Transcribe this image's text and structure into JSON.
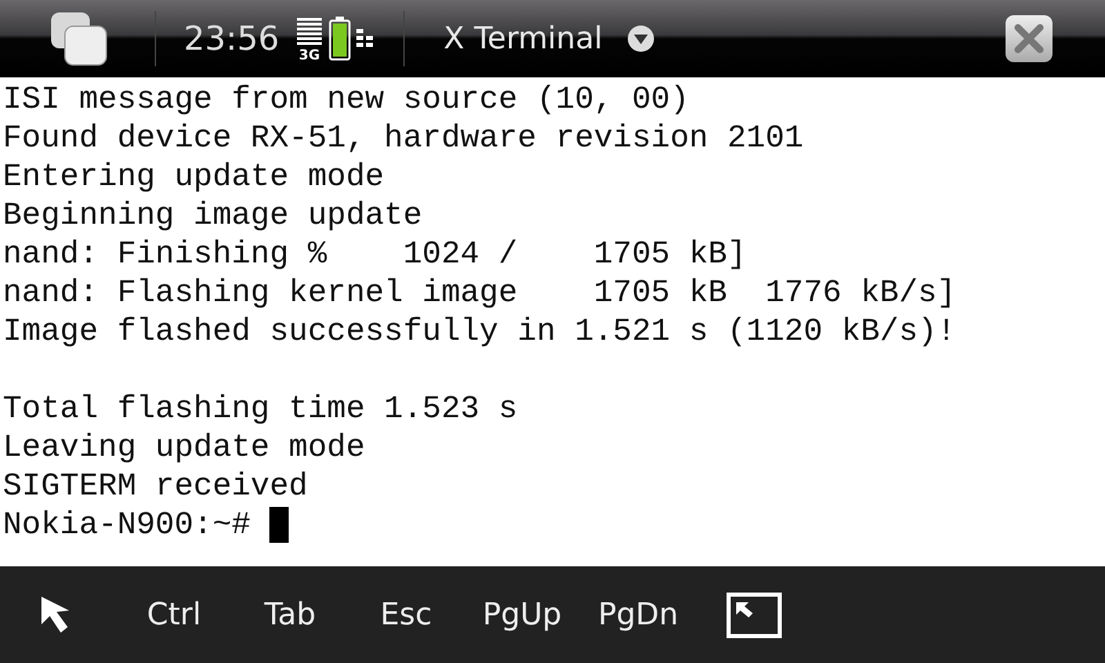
{
  "status_bar": {
    "time": "23:56",
    "network": "3G"
  },
  "window": {
    "title": "X Terminal"
  },
  "terminal": {
    "blocks": [
      [
        "ISI message from new source (10, 00)",
        "Found device RX-51, hardware revision 2101",
        "Entering update mode",
        "Beginning image update",
        "nand: Finishing %    1024 /    1705 kB]",
        "nand: Flashing kernel image    1705 kB  1776 kB/s]",
        "Image flashed successfully in 1.521 s (1120 kB/s)!"
      ],
      [
        "Total flashing time 1.523 s",
        "Leaving update mode",
        "SIGTERM received"
      ]
    ],
    "prompt": "Nokia-N900:~#"
  },
  "toolbar": {
    "keys": [
      {
        "kind": "pointer"
      },
      {
        "kind": "key",
        "label": "Ctrl"
      },
      {
        "kind": "key",
        "label": "Tab"
      },
      {
        "kind": "key",
        "label": "Esc"
      },
      {
        "kind": "key",
        "label": "PgUp"
      },
      {
        "kind": "key",
        "label": "PgDn"
      },
      {
        "kind": "fullscreen"
      }
    ]
  }
}
